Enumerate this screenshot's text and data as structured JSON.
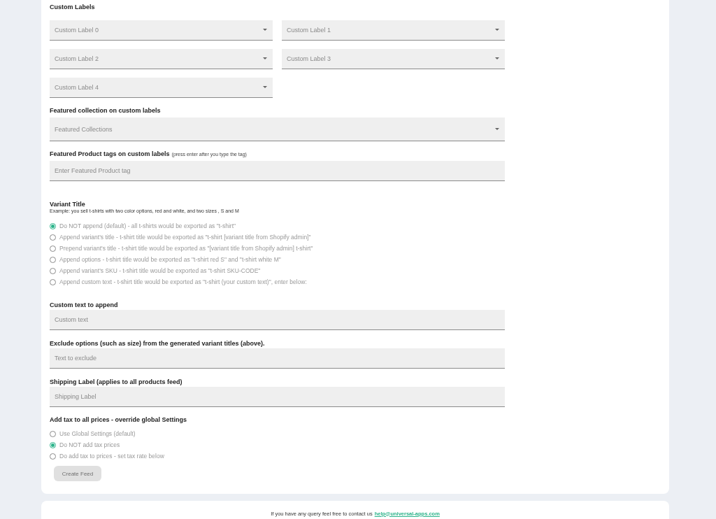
{
  "custom_labels": {
    "title": "Custom Labels",
    "selects": [
      {
        "placeholder": "Custom Label 0"
      },
      {
        "placeholder": "Custom Label 1"
      },
      {
        "placeholder": "Custom Label 2"
      },
      {
        "placeholder": "Custom Label 3"
      },
      {
        "placeholder": "Custom Label 4"
      }
    ]
  },
  "featured_collection": {
    "label": "Featured collection on custom labels",
    "placeholder": "Featured Collections"
  },
  "featured_tags": {
    "label": "Featured Product tags on custom labels",
    "hint": "(press enter after you type the tag)",
    "placeholder": "Enter Featured Product tag"
  },
  "variant_title": {
    "title": "Variant Title",
    "example": "Example: you sell t-shirts with two color options, red and white, and two sizes , S and M",
    "options": [
      {
        "label": "Do NOT append (default) - all t-shirts would be exported as \"t-shirt\"",
        "selected": true
      },
      {
        "label": "Append variant's title - t-shirt title would be exported as \"t-shirt [variant title from Shopify admin]\"",
        "selected": false
      },
      {
        "label": "Prepend variant's title - t-shirt title would be exported as \"[variant title from Shopify admin] t-shirt\"",
        "selected": false
      },
      {
        "label": "Append options - t-shirt title would be exported as \"t-shirt red S\" and \"t-shirt white M\"",
        "selected": false
      },
      {
        "label": "Append variant's SKU - t-shirt title would be exported as \"t-shirt SKU-CODE\"",
        "selected": false
      },
      {
        "label": "Append custom text - t-shirt title would be exported as \"t-shirt (your custom text)\", enter below:",
        "selected": false
      }
    ]
  },
  "text_fields": [
    {
      "label": "Custom text to append",
      "placeholder": "Custom text"
    },
    {
      "label": "Exclude options (such as size) from the generated variant titles (above).",
      "placeholder": "Text to exclude"
    },
    {
      "label": "Shipping Label (applies to all products feed)",
      "placeholder": "Shipping Label"
    }
  ],
  "tax": {
    "title": "Add tax to all prices - override global Settings",
    "options": [
      {
        "label": "Use Global Settings (default)",
        "selected": false
      },
      {
        "label": "Do NOT add tax prices",
        "selected": true
      },
      {
        "label": "Do add tax to prices - set tax rate below",
        "selected": false
      }
    ]
  },
  "create_button": {
    "label": "Create Feed",
    "disabled": true
  },
  "footer": {
    "text": "If you have any query feel free to contact us",
    "link": "help@universal-apps.com"
  }
}
